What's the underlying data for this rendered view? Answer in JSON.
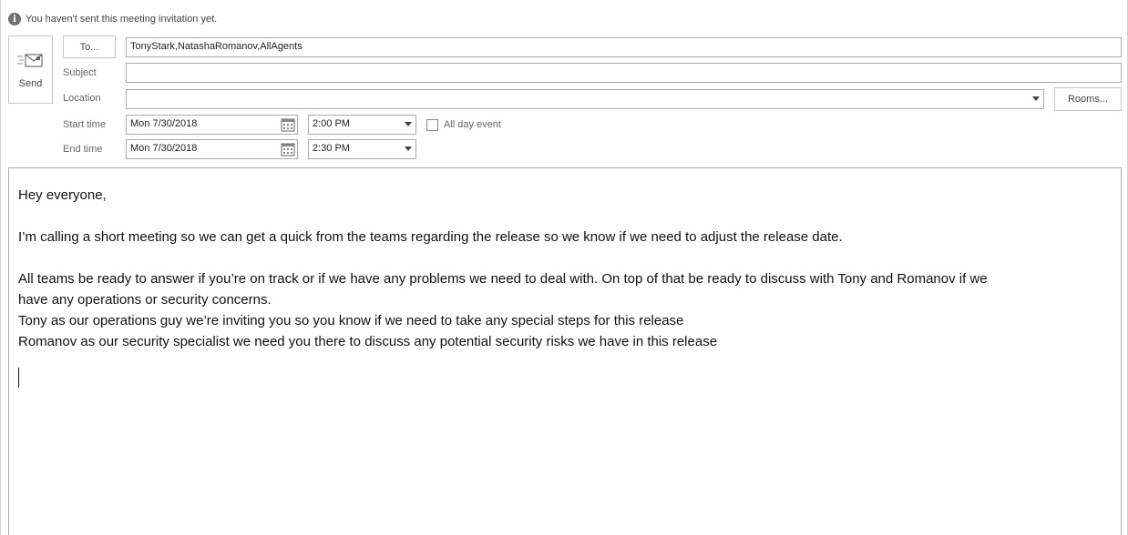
{
  "info_bar": {
    "icon": "info-icon",
    "text": "You haven't sent this meeting invitation yet."
  },
  "send_button": {
    "icon": "envelope-send-icon",
    "label": "Send"
  },
  "to_button": {
    "label": "To..."
  },
  "to_field": {
    "value": "TonyStark,NatashaRomanov,AllAgents"
  },
  "subject": {
    "label": "Subject",
    "value": ""
  },
  "location": {
    "label": "Location",
    "value": ""
  },
  "rooms_button": {
    "label": "Rooms..."
  },
  "start": {
    "label": "Start time",
    "date": "Mon 7/30/2018",
    "time": "2:00 PM"
  },
  "end": {
    "label": "End time",
    "date": "Mon 7/30/2018",
    "time": "2:30 PM"
  },
  "all_day": {
    "label": "All day event",
    "checked": false
  },
  "body": {
    "greeting": "Hey everyone,",
    "para1": "I’m calling a short meeting so we can get a quick from the teams regarding the release so we know if we need to adjust the release date.",
    "para2_line1": "All teams be ready to answer if you’re on track or if we have any problems we need to deal with. On top of that be ready to discuss with Tony and Romanov if we",
    "para2_line2": "have any operations or security concerns.",
    "line_tony": "Tony as our operations guy we’re inviting you so you know if we need to take any special steps for this release",
    "line_romanov": "Romanov as our security specialist we need you there to discuss any potential security risks we have in this release"
  }
}
